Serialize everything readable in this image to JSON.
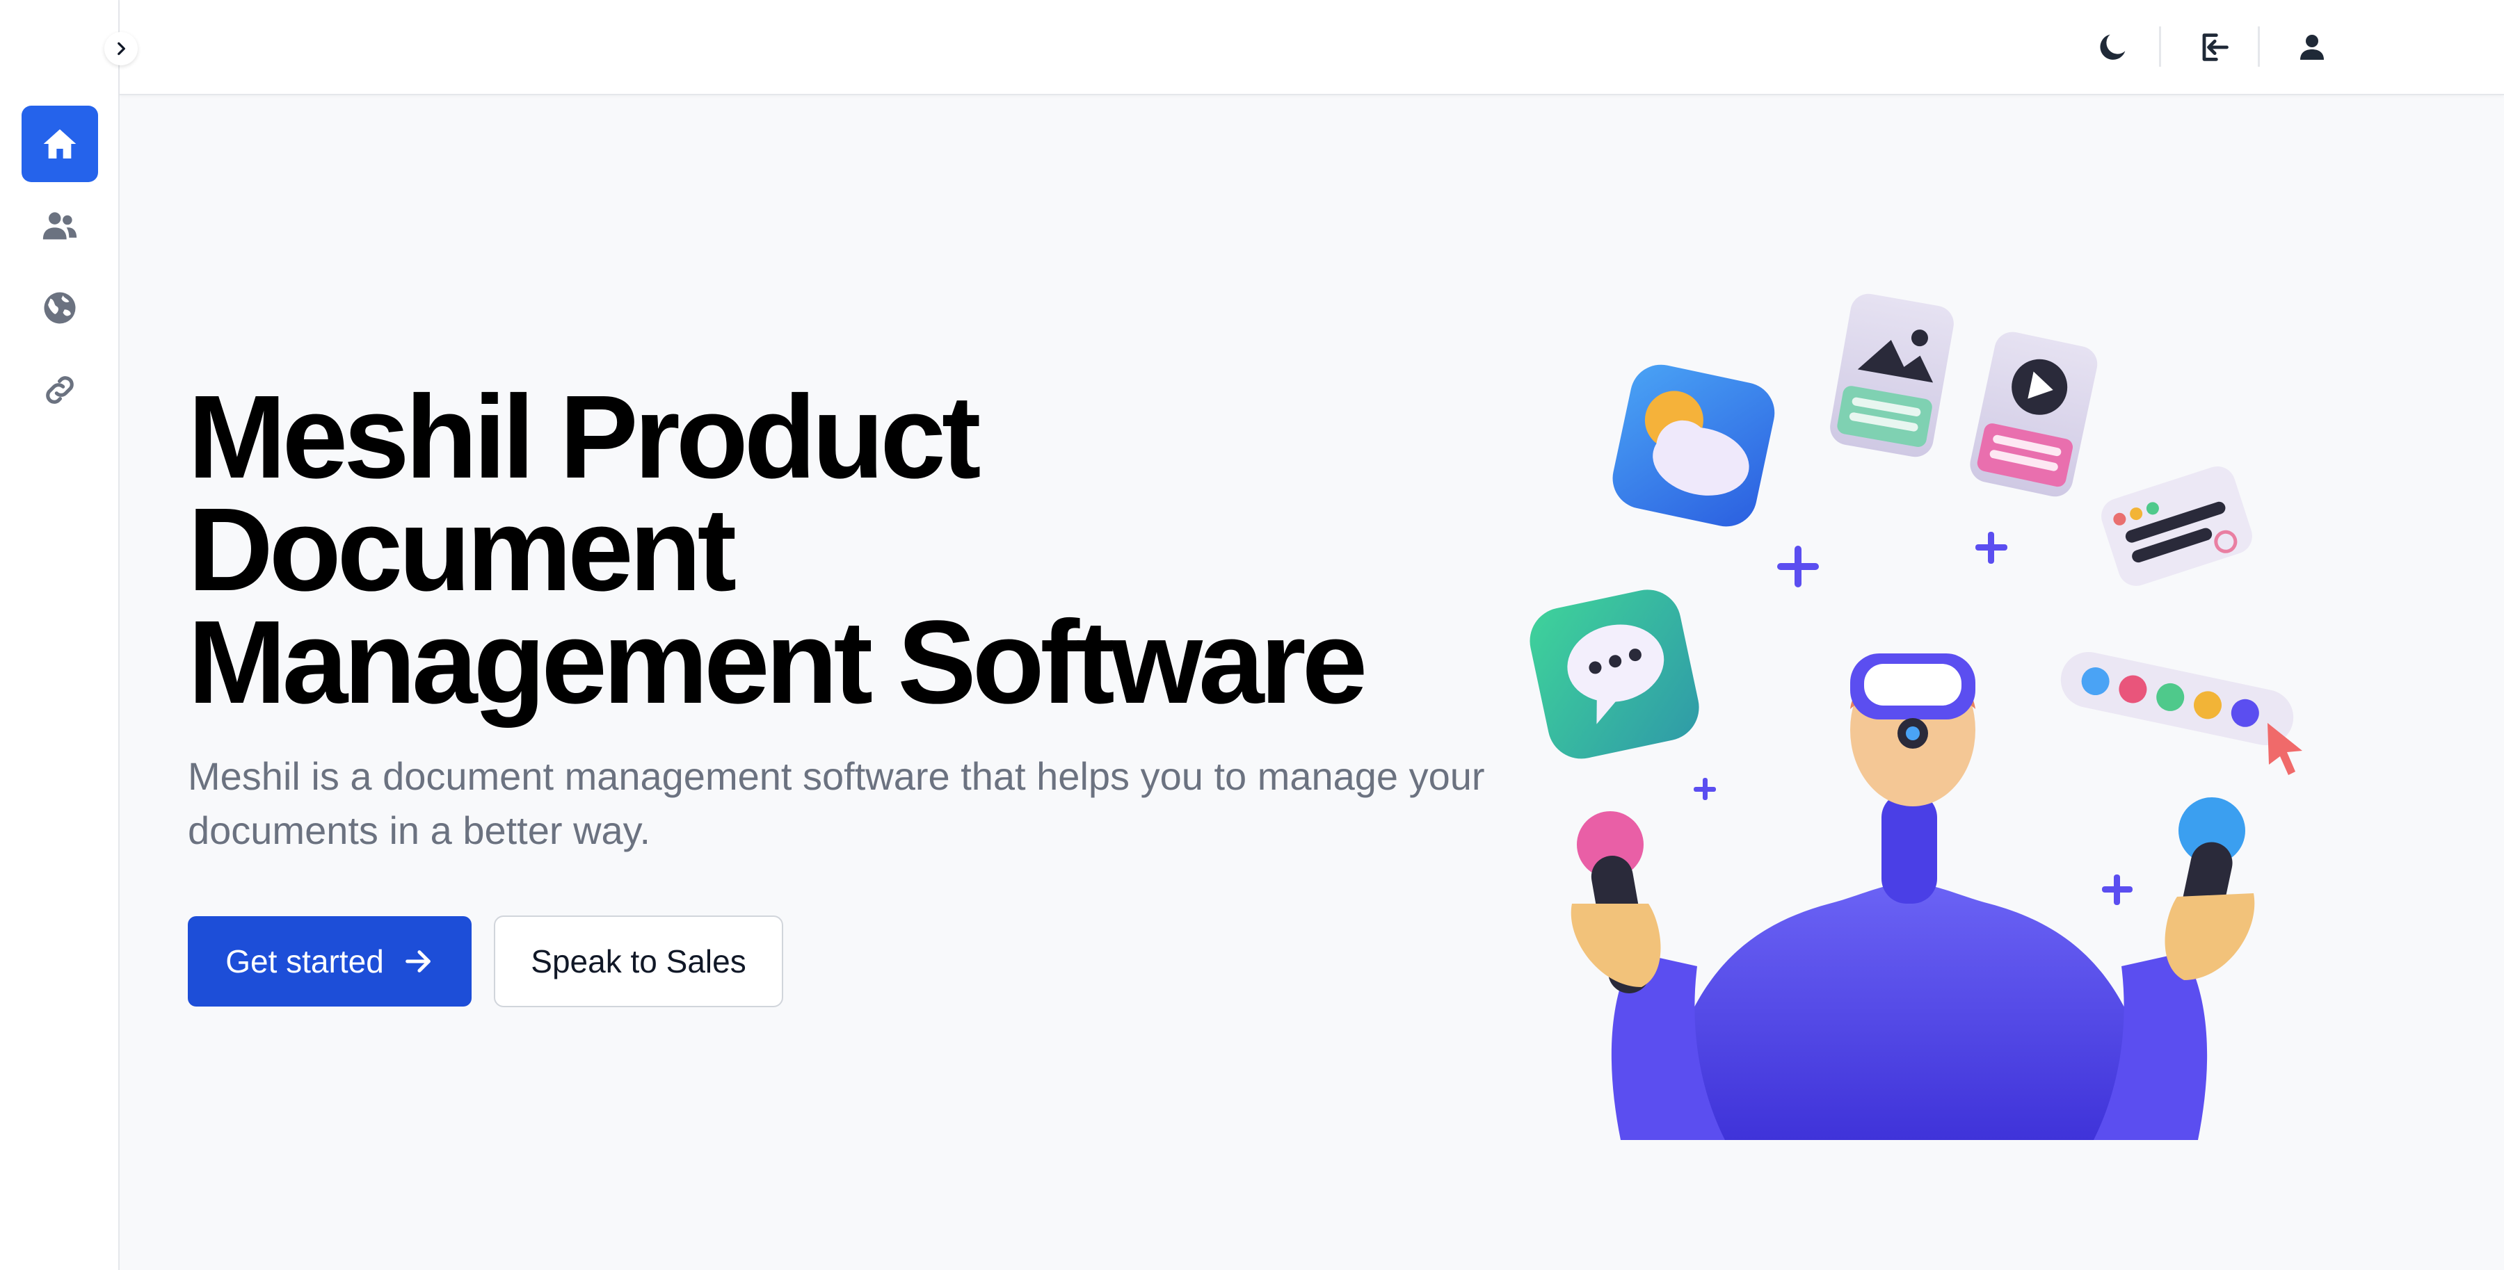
{
  "sidebar": {
    "items": [
      {
        "icon": "home-icon",
        "active": true
      },
      {
        "icon": "users-icon",
        "active": false
      },
      {
        "icon": "globe-icon",
        "active": false
      },
      {
        "icon": "link-icon",
        "active": false
      }
    ]
  },
  "topbar": {
    "icons": [
      "moon-icon",
      "sign-out-icon",
      "user-icon"
    ]
  },
  "hero": {
    "title_lines": [
      "Meshil Product",
      "Document",
      "Management Software"
    ],
    "description": "Meshil is a document management software that helps you to manage your documents in a better way.",
    "primary_button": "Get started",
    "secondary_button": "Speak to Sales"
  },
  "colors": {
    "accent": "#2563eb",
    "primary_button": "#1d4ed8",
    "background": "#f8f9fb",
    "text_muted": "#6b7280",
    "illustration_purple": "#5b4ef0"
  }
}
